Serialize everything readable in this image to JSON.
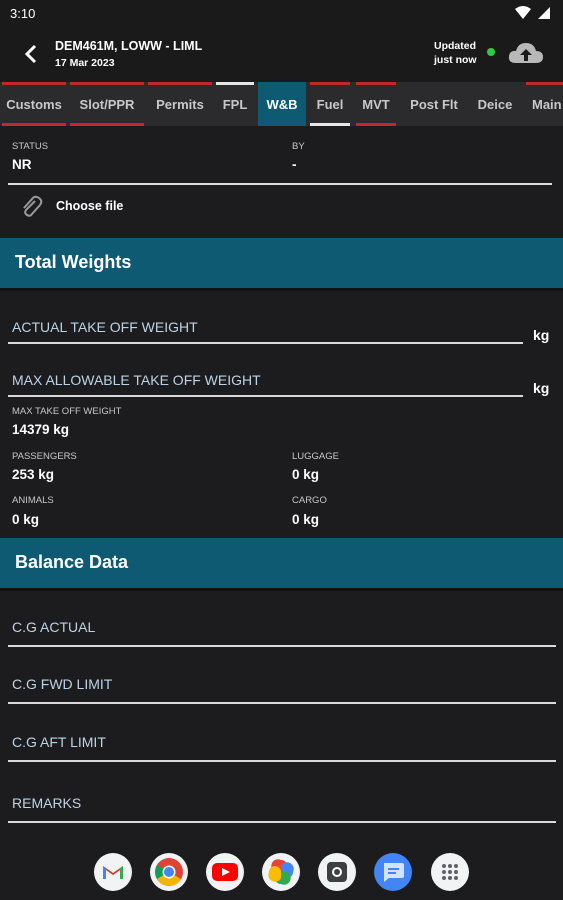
{
  "status_bar": {
    "time": "3:10"
  },
  "header": {
    "title": "DEM461M, LOWW - LIML",
    "date": "17 Mar 2023",
    "updated_line1": "Updated",
    "updated_line2": "just now"
  },
  "tabs": [
    "Customs",
    "Slot/PPR",
    "Permits",
    "FPL",
    "W&B",
    "Fuel",
    "MVT",
    "Post Flt",
    "Deice",
    "Main"
  ],
  "active_tab": "W&B",
  "status": {
    "status_label": "STATUS",
    "status_value": "NR",
    "by_label": "BY",
    "by_value": "-"
  },
  "choose_file": "Choose file",
  "total_weights": {
    "title": "Total Weights",
    "actual_tow_label": "ACTUAL TAKE OFF WEIGHT",
    "actual_tow_unit": "kg",
    "max_allow_label": "MAX ALLOWABLE TAKE OFF WEIGHT",
    "max_allow_unit": "kg",
    "mtow_label": "MAX TAKE OFF WEIGHT",
    "mtow_value": "14379 kg",
    "passengers_label": "PASSENGERS",
    "passengers_value": "253 kg",
    "luggage_label": "LUGGAGE",
    "luggage_value": "0 kg",
    "animals_label": "ANIMALS",
    "animals_value": "0 kg",
    "cargo_label": "CARGO",
    "cargo_value": "0 kg"
  },
  "balance_data": {
    "title": "Balance Data",
    "cg_actual": "C.G ACTUAL",
    "cg_fwd": "C.G FWD LIMIT",
    "cg_aft": "C.G AFT LIMIT",
    "remarks": "REMARKS"
  },
  "dock_apps": [
    "gmail-icon",
    "chrome-icon",
    "youtube-icon",
    "photos-icon",
    "camera-icon",
    "messages-icon",
    "app-drawer-icon"
  ],
  "colors": {
    "accent": "#0e5a73",
    "tab_red": "#c0282d",
    "online": "#2ecc40"
  }
}
